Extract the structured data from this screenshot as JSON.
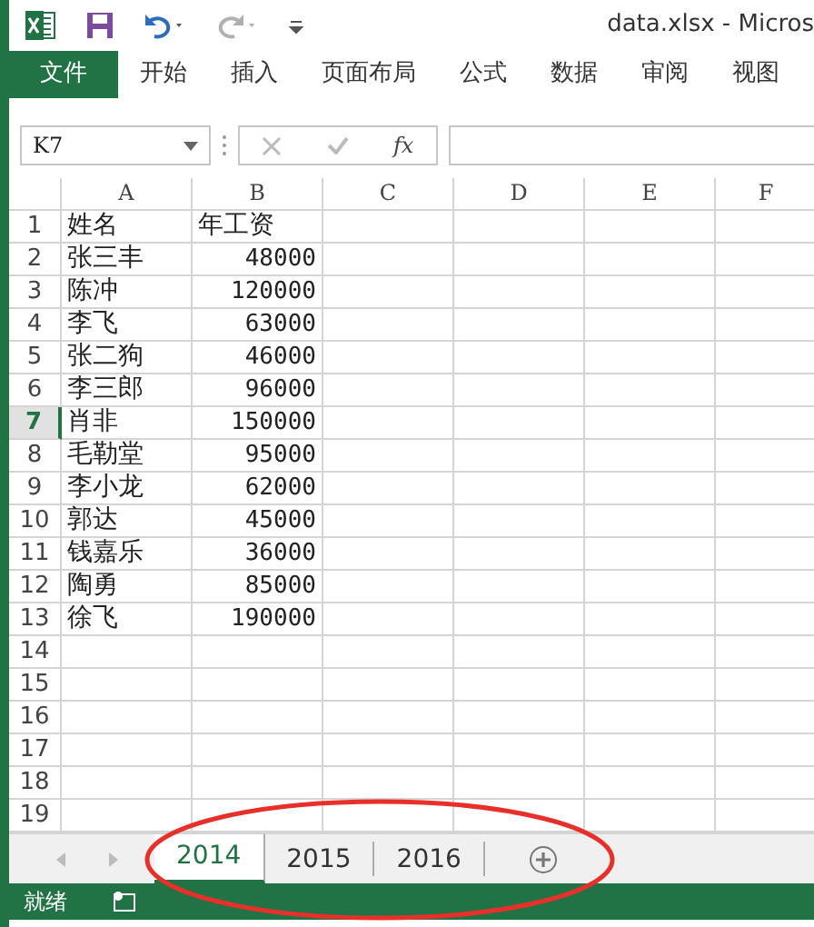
{
  "window": {
    "title": "data.xlsx - Micros"
  },
  "ribbon_tabs": [
    {
      "label": "文件",
      "kind": "file"
    },
    {
      "label": "开始",
      "kind": "tab"
    },
    {
      "label": "插入",
      "kind": "tab"
    },
    {
      "label": "页面布局",
      "kind": "tab"
    },
    {
      "label": "公式",
      "kind": "tab"
    },
    {
      "label": "数据",
      "kind": "tab"
    },
    {
      "label": "审阅",
      "kind": "tab"
    },
    {
      "label": "视图",
      "kind": "tab"
    }
  ],
  "formula_bar": {
    "name_box": "K7",
    "fx": "fx"
  },
  "columns": [
    "A",
    "B",
    "C",
    "D",
    "E",
    "F"
  ],
  "rows": [
    {
      "number": "1",
      "selected": false,
      "cells": [
        "姓名",
        "年工资"
      ]
    },
    {
      "number": "2",
      "selected": false,
      "cells": [
        "张三丰",
        "48000"
      ]
    },
    {
      "number": "3",
      "selected": false,
      "cells": [
        "陈冲",
        "120000"
      ]
    },
    {
      "number": "4",
      "selected": false,
      "cells": [
        "李飞",
        "63000"
      ]
    },
    {
      "number": "5",
      "selected": false,
      "cells": [
        "张二狗",
        "46000"
      ]
    },
    {
      "number": "6",
      "selected": false,
      "cells": [
        "李三郎",
        "96000"
      ]
    },
    {
      "number": "7",
      "selected": true,
      "cells": [
        "肖非",
        "150000"
      ]
    },
    {
      "number": "8",
      "selected": false,
      "cells": [
        "毛勒堂",
        "95000"
      ]
    },
    {
      "number": "9",
      "selected": false,
      "cells": [
        "李小龙",
        "62000"
      ]
    },
    {
      "number": "10",
      "selected": false,
      "cells": [
        "郭达",
        "45000"
      ]
    },
    {
      "number": "11",
      "selected": false,
      "cells": [
        "钱嘉乐",
        "36000"
      ]
    },
    {
      "number": "12",
      "selected": false,
      "cells": [
        "陶勇",
        "85000"
      ]
    },
    {
      "number": "13",
      "selected": false,
      "cells": [
        "徐飞",
        "190000"
      ]
    },
    {
      "number": "14",
      "selected": false,
      "cells": []
    },
    {
      "number": "15",
      "selected": false,
      "cells": []
    },
    {
      "number": "16",
      "selected": false,
      "cells": []
    },
    {
      "number": "17",
      "selected": false,
      "cells": []
    },
    {
      "number": "18",
      "selected": false,
      "cells": []
    },
    {
      "number": "19",
      "selected": false,
      "cells": []
    }
  ],
  "sheet_tabs": [
    {
      "label": "2014",
      "selected": true
    },
    {
      "label": "2015",
      "selected": false
    },
    {
      "label": "2016",
      "selected": false
    }
  ],
  "status_bar": {
    "text": "就绪"
  }
}
